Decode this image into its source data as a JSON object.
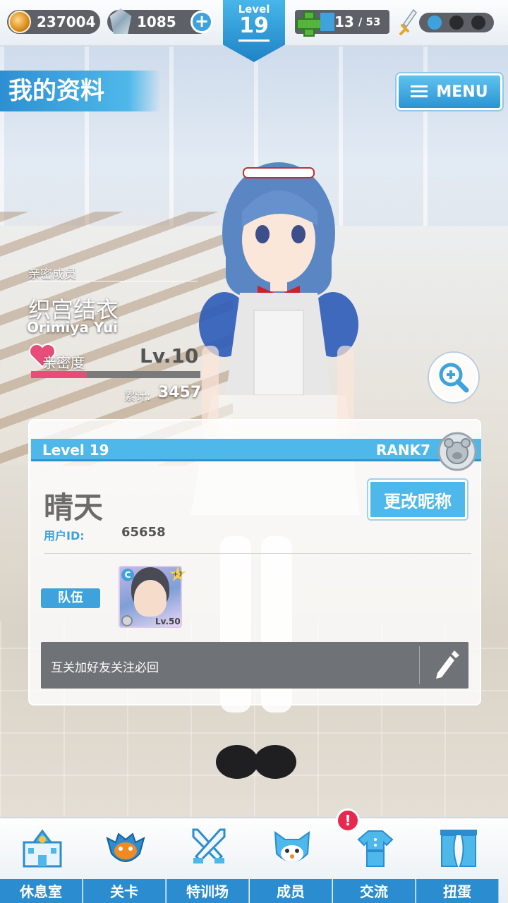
{
  "topbar": {
    "coins": "237004",
    "gems": "1085",
    "gem_add_label": "+",
    "level_label": "Level",
    "level_value": "19",
    "stamina_current": "13",
    "stamina_max": "/ 53",
    "sword_slots": [
      true,
      false,
      false
    ]
  },
  "header": {
    "title": "我的资料",
    "menu_label": "MENU"
  },
  "member": {
    "section_label": "亲密成员",
    "name": "织宫结衣",
    "romaji": "Orimiya Yui",
    "affinity_label": "亲密度",
    "affinity_level": "Lv.10",
    "affinity_progress": 0.33,
    "total_label": "累计:",
    "total_value": "3457"
  },
  "profile": {
    "level_text": "Level 19",
    "rank_text": "RANK7",
    "nickname": "晴天",
    "user_id_label": "用户ID:",
    "user_id": "65658",
    "rename_label": "更改昵称",
    "team_label": "队伍",
    "team_card_level": "Lv.50",
    "team_card_plus": "+1",
    "team_card_class": "C",
    "bio": "互关加好友关注必回"
  },
  "nav": {
    "items": [
      {
        "label": "休息室",
        "icon": "building-icon"
      },
      {
        "label": "关卡",
        "icon": "monster-icon"
      },
      {
        "label": "特训场",
        "icon": "crossed-swords-icon"
      },
      {
        "label": "成员",
        "icon": "cat-mascot-icon"
      },
      {
        "label": "交流",
        "icon": "dress-icon"
      },
      {
        "label": "扭蛋",
        "icon": "curtain-icon"
      }
    ],
    "notification": "!"
  },
  "colors": {
    "accent": "#3ea3dc",
    "nav_bar": "#2b8dd0",
    "affinity": "#e84d7a",
    "notification": "#e8284f"
  }
}
